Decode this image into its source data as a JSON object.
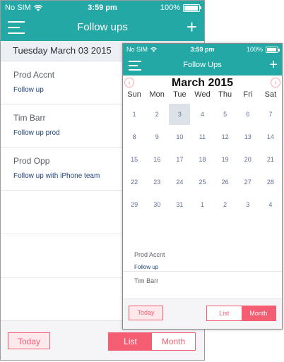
{
  "back": {
    "status": {
      "carrier": "No SIM",
      "time": "3:59 pm",
      "battery": "100%"
    },
    "nav": {
      "title": "Follow ups"
    },
    "date_header": "Tuesday March 03 2015",
    "items": [
      {
        "name": "Prod Accnt",
        "note": "Follow up"
      },
      {
        "name": "Tim Barr",
        "note": "Follow up prod"
      },
      {
        "name": "Prod Opp",
        "note": "Follow up with iPhone team"
      }
    ],
    "bottom": {
      "today": "Today",
      "list": "List",
      "month": "Month",
      "selected": "List"
    }
  },
  "front": {
    "status": {
      "carrier": "No SIM",
      "time": "3:59 pm",
      "battery": "100%"
    },
    "nav": {
      "title": "Follow Ups"
    },
    "month_title": "March 2015",
    "weekdays": [
      "Sun",
      "Mon",
      "Tue",
      "Wed",
      "Thu",
      "Fri",
      "Sat"
    ],
    "days": [
      "1",
      "2",
      "3",
      "4",
      "5",
      "6",
      "7",
      "8",
      "9",
      "10",
      "11",
      "12",
      "13",
      "14",
      "15",
      "16",
      "17",
      "18",
      "19",
      "20",
      "21",
      "22",
      "23",
      "24",
      "25",
      "26",
      "27",
      "28",
      "29",
      "30",
      "31",
      "1",
      "2",
      "3",
      "4"
    ],
    "selected_day": "3",
    "items": [
      {
        "name": "Prod Accnt",
        "note": "Follow up"
      },
      {
        "name": "Tim Barr"
      }
    ],
    "bottom": {
      "today": "Today",
      "list": "List",
      "month": "Month",
      "selected": "Month"
    }
  },
  "colors": {
    "teal": "#24a8a6",
    "accent": "#f55d72",
    "selected_day_bg": "#dde2e8"
  },
  "icons": {
    "menu": "hamburger-icon",
    "add": "plus-icon",
    "wifi": "wifi-icon",
    "battery": "battery-icon",
    "prev": "chevron-left-icon",
    "next": "chevron-right-icon"
  }
}
